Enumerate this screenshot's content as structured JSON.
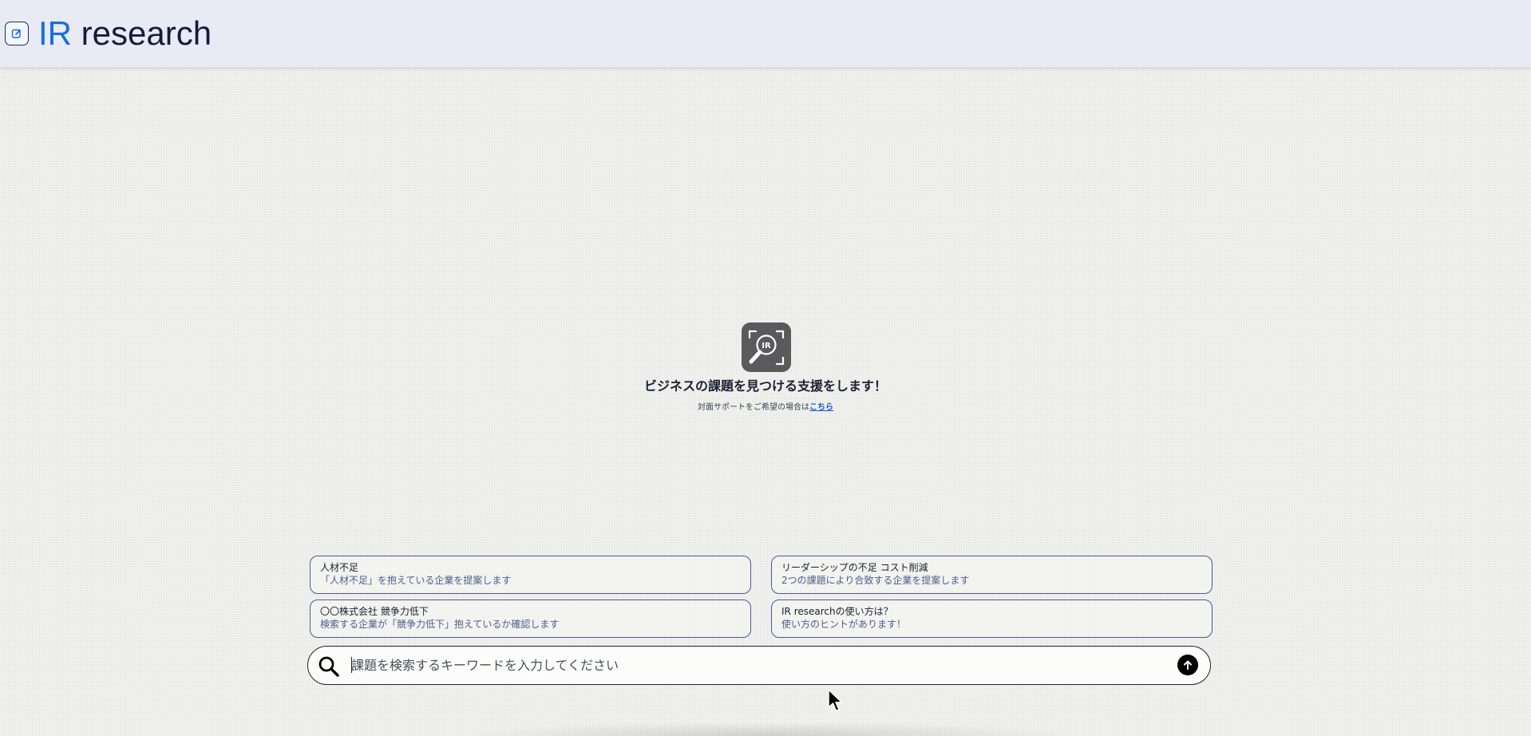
{
  "header": {
    "logo_ir": "IR",
    "logo_rest": "research",
    "new_chat_icon": "edit-icon"
  },
  "hero": {
    "icon": "ir-magnifier-icon",
    "icon_text": "IR",
    "tagline": "ビジネスの課題を見つける支援をします！",
    "support_text": "対面サポートをご希望の場合は",
    "support_link": "こちら"
  },
  "suggestions": [
    {
      "title": "人材不足",
      "subtitle": "「人材不足」を抱えている企業を提案します"
    },
    {
      "title": "リーダーシップの不足 コスト削減",
      "subtitle": "2つの課題により合致する企業を提案します"
    },
    {
      "title": "〇〇株式会社 競争力低下",
      "subtitle": "検索する企業が「競争力低下」抱えているか確認します"
    },
    {
      "title": "IR researchの使い方は？",
      "subtitle": "使い方のヒントがあります！"
    }
  ],
  "search": {
    "placeholder": "課題を検索するキーワードを入力してください",
    "value": "",
    "search_icon": "search-icon",
    "submit_icon": "arrow-up-icon"
  },
  "colors": {
    "accent_blue": "#1a6de2",
    "navy": "#141c3d",
    "header_bg": "#e8ebf4",
    "card_border": "#4f5890"
  }
}
